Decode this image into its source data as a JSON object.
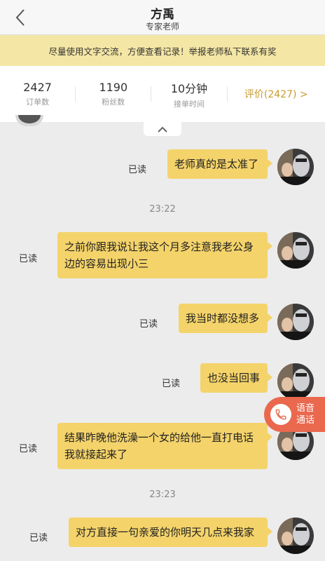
{
  "header": {
    "title": "方禹",
    "subtitle": "专家老师"
  },
  "notice": {
    "text": "尽量使用文字交流，方便查看记录！举报老师私下联系有奖"
  },
  "stats": {
    "orders": {
      "value": "2427",
      "label": "订单数"
    },
    "fans": {
      "value": "1190",
      "label": "粉丝数"
    },
    "response": {
      "value": "10分钟",
      "label": "接单时间"
    },
    "review_label": "评价(2427) >"
  },
  "messages": [
    {
      "text": "老师真的是太准了",
      "status": "已读"
    },
    {
      "time": "23:22"
    },
    {
      "text": "之前你跟我说让我这个月多注意我老公身边的容易出现小三",
      "status": "已读"
    },
    {
      "text": "我当时都没想多",
      "status": "已读"
    },
    {
      "text": "也没当回事",
      "status": "已读"
    },
    {
      "text": "结果昨晚他洗澡一个女的给他一直打电话我就接起来了",
      "status": "已读"
    },
    {
      "time": "23:23"
    },
    {
      "text": "对方直接一句亲爱的你明天几点来我家",
      "status": "已读"
    }
  ],
  "voice_call": {
    "label": "语音通话"
  },
  "colors": {
    "bubble": "#f4d36a",
    "notice_bg": "#f4e6a4",
    "review": "#c99a2e",
    "voice": "#e9684e"
  }
}
